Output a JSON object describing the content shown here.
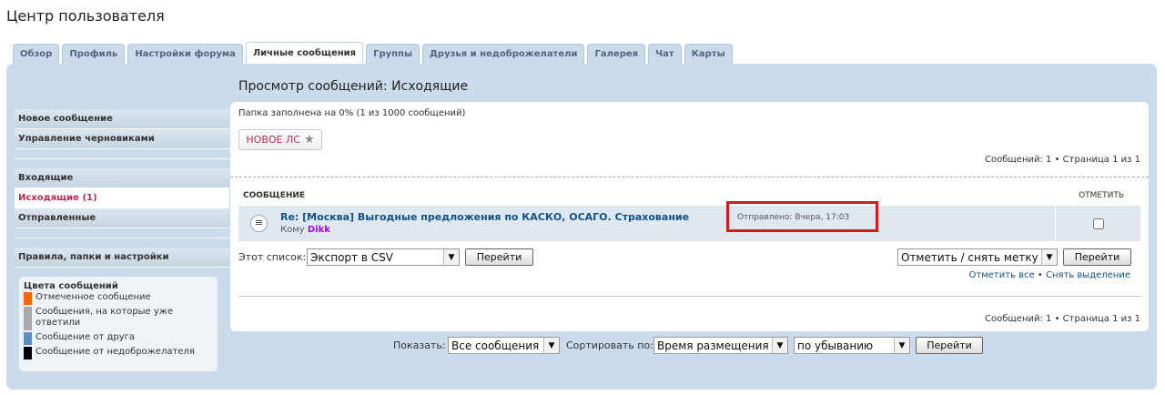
{
  "page_title": "Центр пользователя",
  "tabs": [
    "Обзор",
    "Профиль",
    "Настройки форума",
    "Личные сообщения",
    "Группы",
    "Друзья и недоброжелатели",
    "Галерея",
    "Чат",
    "Карты"
  ],
  "active_tab": "Личные сообщения",
  "sidebar": {
    "compose": "Новое сообщение",
    "drafts": "Управление черновиками",
    "inbox": "Входящие",
    "outbox": "Исходящие (1)",
    "sent": "Отправленные",
    "rules": "Правила, папки и настройки"
  },
  "legend": {
    "title": "Цвета сообщений",
    "items": [
      {
        "label": "Отмеченное сообщение",
        "color": "#ff6600"
      },
      {
        "label": "Сообщения, на которые уже ответили",
        "color": "#aaaaaa"
      },
      {
        "label": "Сообщение от друга",
        "color": "#5c8fbe"
      },
      {
        "label": "Сообщение от недоброжелателя",
        "color": "#000000"
      }
    ]
  },
  "content": {
    "title": "Просмотр сообщений: Исходящие",
    "folder_status": "Папка заполнена на 0% (1 из 1000 сообщений)",
    "new_pm_label": "НОВОЕ ЛС",
    "pagination": "Сообщений: 1 • Страница 1 из 1",
    "col_message": "СООБЩЕНИЕ",
    "col_mark": "ОТМЕТИТЬ",
    "message": {
      "subject": "Re: [Москва] Выгодные предложения по КАСКО, ОСАГО. Страхование",
      "to_label": "Кому",
      "to_user": "Dikk",
      "sent": "Отправлено: Вчера, 17:03"
    },
    "export_label": "Этот список:",
    "export_select": "Экспорт в CSV",
    "go": "Перейти",
    "mark_select": "Отметить / снять метку",
    "mark_all": "Отметить все",
    "unmark_all": "Снять выделение"
  },
  "sort": {
    "show_label": "Показать:",
    "show_value": "Все сообщения",
    "sort_label": "Сортировать по:",
    "sort_value": "Время размещения",
    "order_value": "по убыванию",
    "go": "Перейти"
  },
  "colors": {
    "accent_red": "#bc2a4d",
    "link_blue": "#105289",
    "highlight": "#e0141e"
  }
}
